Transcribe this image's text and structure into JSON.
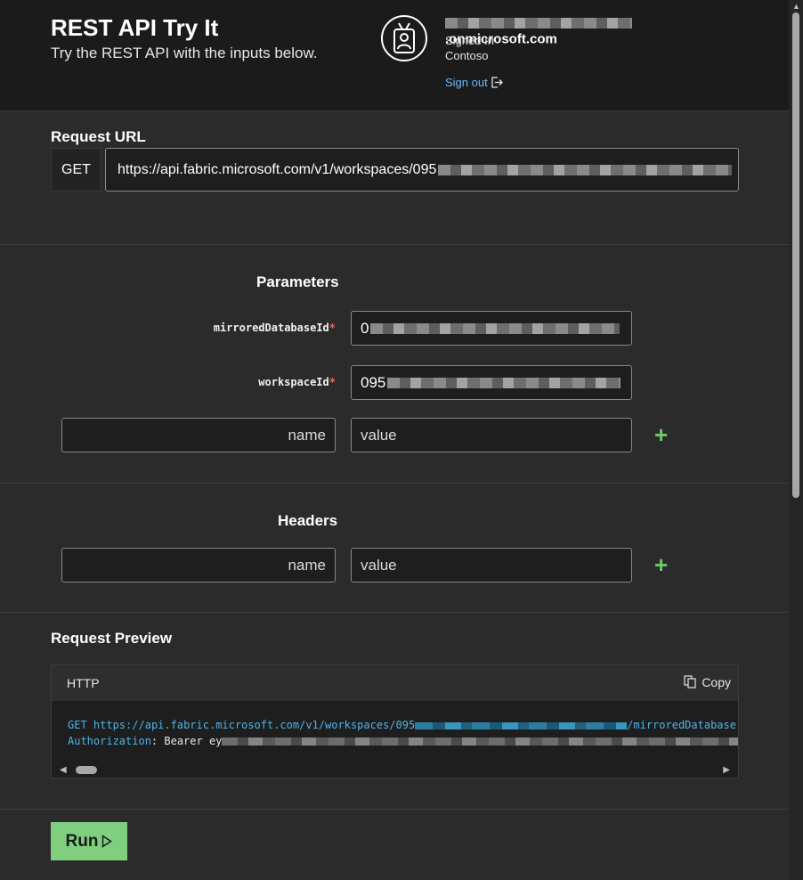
{
  "header": {
    "title": "REST API Try It",
    "subtitle": "Try the REST API with the inputs below.",
    "user_email_suffix": ".onmicrosoft.com",
    "signed_in_label": "Signed In",
    "tenant": "Contoso",
    "sign_out_label": "Sign out",
    "badge_icon": "id-badge-icon"
  },
  "request_url": {
    "section_title": "Request URL",
    "method": "GET",
    "url_visible": "https://api.fabric.microsoft.com/v1/workspaces/095"
  },
  "parameters": {
    "section_title": "Parameters",
    "items": [
      {
        "name": "mirroredDatabaseId",
        "required_mark": "*",
        "value_visible": "0"
      },
      {
        "name": "workspaceId",
        "required_mark": "*",
        "value_visible": "095"
      }
    ],
    "new_name_placeholder": "name",
    "new_value_placeholder": "value",
    "add_label": "+"
  },
  "headers": {
    "section_title": "Headers",
    "new_name_placeholder": "name",
    "new_value_placeholder": "value",
    "add_label": "+"
  },
  "request_preview": {
    "section_title": "Request Preview",
    "language": "HTTP",
    "copy_label": "Copy",
    "line1_method": "GET",
    "line1_url_start": "https://api.fabric.microsoft.com/v1/workspaces/095",
    "line1_url_end": "/mirroredDatabase",
    "line2_key": "Authorization",
    "line2_value_start": ": Bearer ey"
  },
  "run_button": {
    "label": "Run"
  },
  "colors": {
    "run_button": "#7fcf7f",
    "link": "#6cb8f6",
    "plus": "#6ccb6c",
    "code_keyword": "#4fb3e8"
  }
}
